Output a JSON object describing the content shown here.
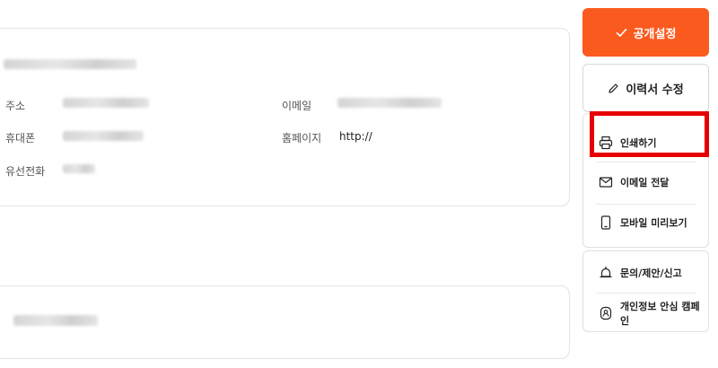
{
  "profile": {
    "labels": {
      "address": "주소",
      "mobile": "휴대폰",
      "landline": "유선전화",
      "email": "이메일",
      "homepage": "홈페이지"
    },
    "homepage_value": "http://"
  },
  "sidebar": {
    "publish_label": "공개설정",
    "edit_label": "이력서 수정",
    "menu": [
      {
        "label": "인쇄하기",
        "icon": "printer-icon"
      },
      {
        "label": "이메일 전달",
        "icon": "mail-icon"
      },
      {
        "label": "모바일 미리보기",
        "icon": "mobile-icon"
      }
    ],
    "extra": [
      {
        "label": "문의/제안/신고",
        "icon": "bell-icon"
      },
      {
        "label": "개인정보 안심 캠페인",
        "icon": "privacy-shield-icon"
      }
    ]
  },
  "colors": {
    "accent": "#fb5a1f",
    "highlight": "#e60000"
  }
}
